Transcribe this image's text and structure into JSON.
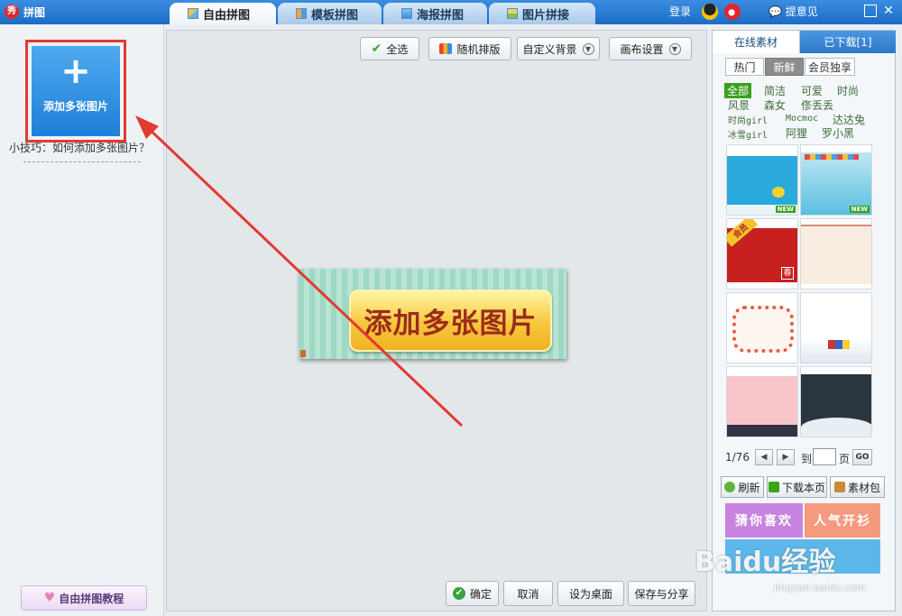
{
  "app": {
    "title": "拼图",
    "logo_glyph": "秀"
  },
  "tabs": [
    {
      "label": "自由拼图",
      "active": true
    },
    {
      "label": "模板拼图",
      "active": false
    },
    {
      "label": "海报拼图",
      "active": false
    },
    {
      "label": "图片拼接",
      "active": false
    }
  ],
  "titlebar": {
    "login": "登录",
    "feedback": "提意见"
  },
  "left": {
    "add_label": "添加多张图片",
    "add_plus": "+",
    "tip": "小技巧：如何添加多张图片？",
    "tutorial": "自由拼图教程"
  },
  "toolbar": {
    "select_all": "全选",
    "random_layout": "随机排版",
    "custom_bg": "自定义背景",
    "canvas_settings": "画布设置"
  },
  "canvas": {
    "placeholder_text": "添加多张图片"
  },
  "bottom": {
    "confirm": "确定",
    "cancel": "取消",
    "set_desktop": "设为桌面",
    "save_share": "保存与分享"
  },
  "right": {
    "tab_online": "在线素材",
    "tab_downloaded": "已下载[1]",
    "filters": [
      "热门",
      "新鲜",
      "会员独享"
    ],
    "categories": [
      "全部",
      "简洁",
      "可爱",
      "时尚",
      "风景",
      "森女",
      "俢丢丢",
      "时尚girl",
      "Mocmoc",
      "达达兔",
      "冰雪girl",
      "阿狸",
      "罗小黑"
    ],
    "thumb_badges": {
      "new": "NEW",
      "vip": "会员",
      "spring": "春"
    },
    "pager": {
      "page": "1/76",
      "to": "到",
      "unit": "页",
      "go": "GO"
    },
    "actions": {
      "refresh": "刷新",
      "download_page": "下载本页",
      "material_pack": "素材包"
    },
    "banners": {
      "guess": "猜你喜欢",
      "popular": "人气开衫"
    }
  },
  "watermark": {
    "brand": "Baidu经验",
    "url": "jingyan.baidu.com"
  },
  "colors": {
    "accent": "#1e7fd8",
    "highlight": "#e23a31",
    "green": "#3aa21c"
  }
}
